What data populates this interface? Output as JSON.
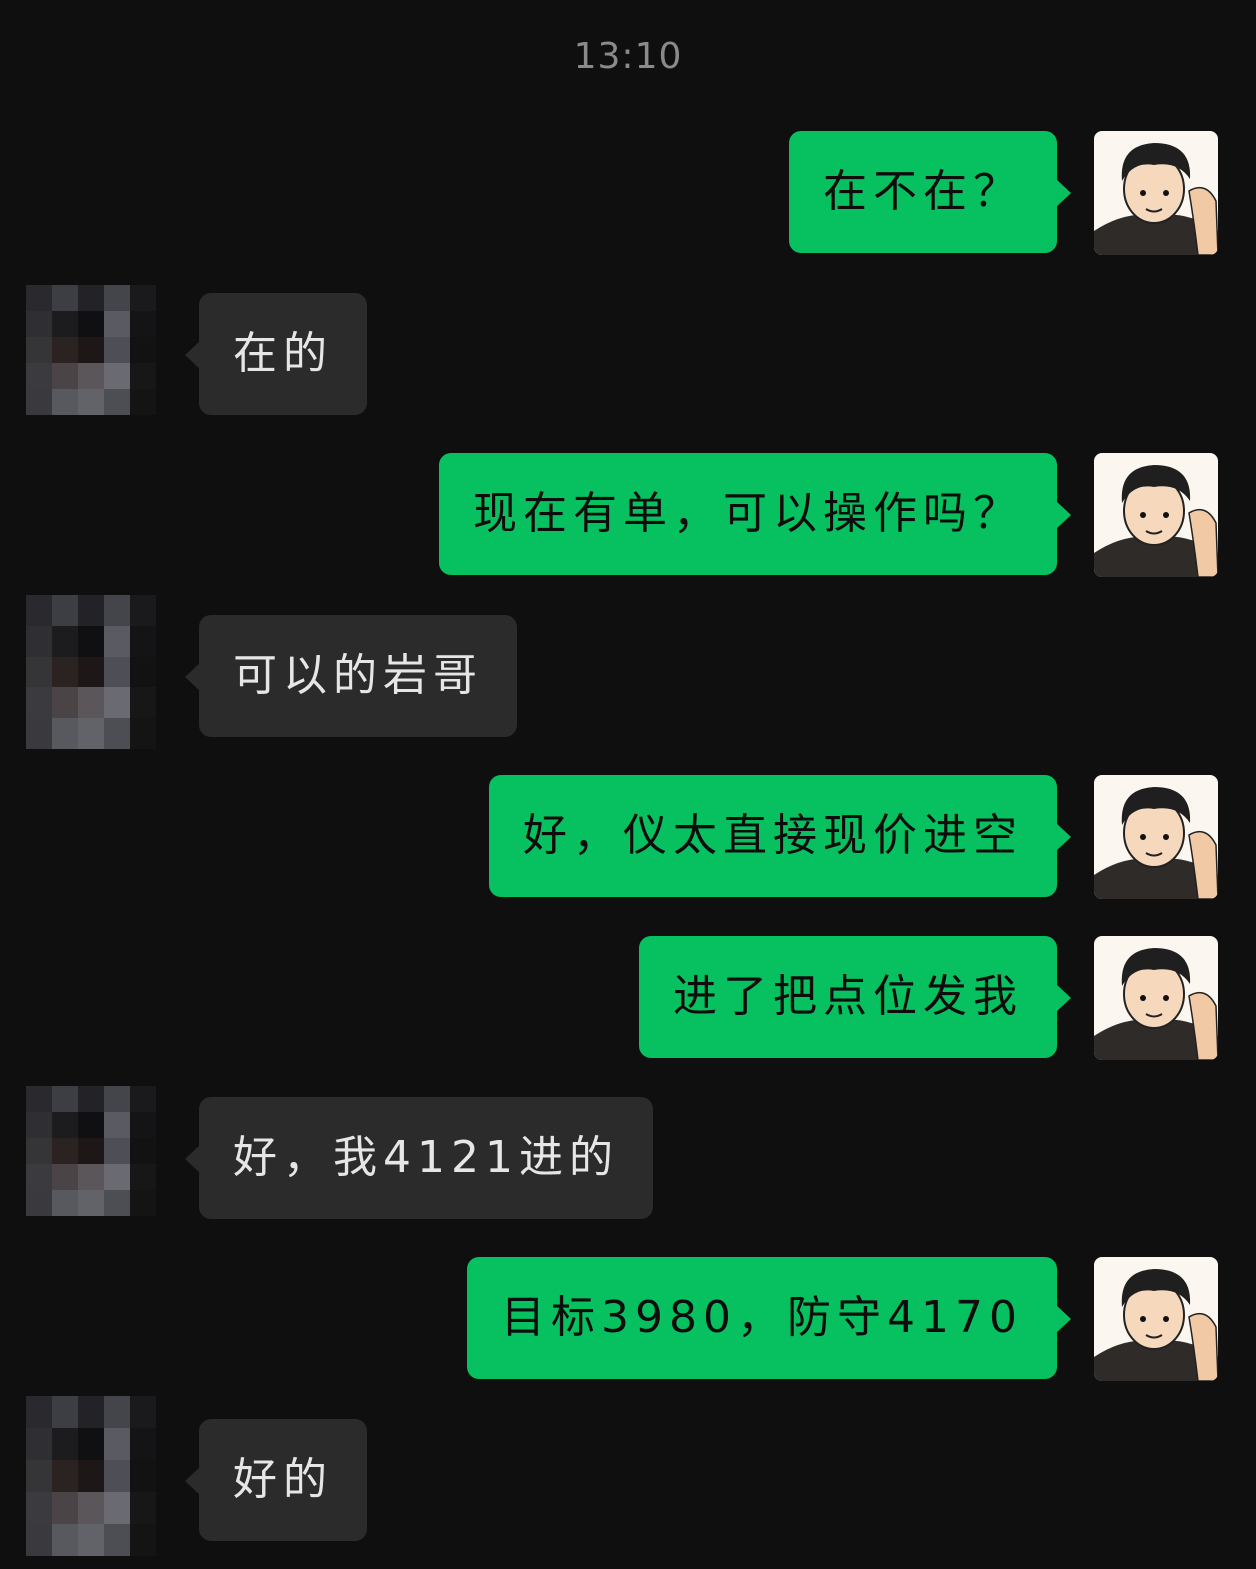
{
  "chat": {
    "timestamp": "13:10",
    "messages": [
      {
        "side": "out",
        "text": "在不在？"
      },
      {
        "side": "in",
        "text": "在的"
      },
      {
        "side": "out",
        "text": "现在有单，可以操作吗？"
      },
      {
        "side": "in",
        "text": "可以的岩哥"
      },
      {
        "side": "out",
        "text": "好，仪太直接现价进空"
      },
      {
        "side": "out",
        "text": "进了把点位发我"
      },
      {
        "side": "in",
        "text": "好，我4121进的"
      },
      {
        "side": "out",
        "text": "目标3980，防守4170"
      },
      {
        "side": "in",
        "text": "好的"
      }
    ]
  },
  "colors": {
    "background": "#0f0f0f",
    "outgoing_bubble": "#07c160",
    "incoming_bubble": "#2b2b2b",
    "timestamp_text": "#8a8a8a"
  },
  "icons": {
    "self_avatar": "cartoon-man-avatar-icon",
    "other_avatar": "pixelated-avatar-icon"
  }
}
